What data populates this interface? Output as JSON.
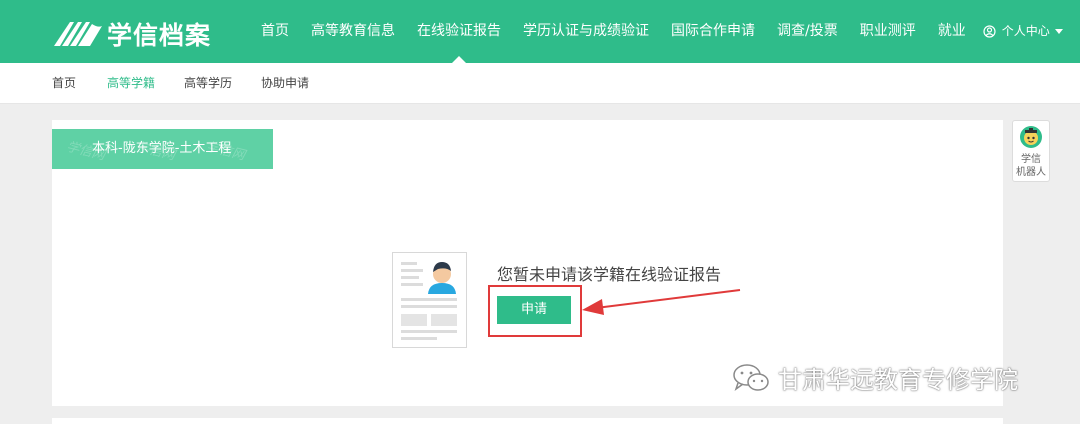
{
  "header": {
    "logo_text": "学信档案",
    "nav": [
      {
        "label": "首页"
      },
      {
        "label": "高等教育信息"
      },
      {
        "label": "在线验证报告",
        "active": true
      },
      {
        "label": "学历认证与成绩验证"
      },
      {
        "label": "国际合作申请"
      },
      {
        "label": "调查/投票"
      },
      {
        "label": "职业测评"
      },
      {
        "label": "就业"
      }
    ],
    "user_label": "个人中心",
    "bg_color": "#2fbc8a"
  },
  "subnav": {
    "items": [
      {
        "label": "首页"
      },
      {
        "label": "高等学籍",
        "active": true
      },
      {
        "label": "高等学历"
      },
      {
        "label": "协助申请"
      }
    ]
  },
  "card": {
    "tag_label": "本科-陇东学院-土木工程",
    "tag_watermark": "学信网",
    "message": "您暂未申请该学籍在线验证报告",
    "apply_label": "申请"
  },
  "robot": {
    "label_line1": "学信",
    "label_line2": "机器人"
  },
  "watermark": {
    "text": "甘肃华远教育专修学院"
  },
  "icons": {
    "logo": "book-logo-icon",
    "user": "user-circle-icon",
    "caret": "caret-down-icon",
    "illustration": "resume-person-icon",
    "arrow": "red-arrow-icon",
    "robot": "robot-avatar-icon",
    "wechat": "wechat-icon"
  },
  "colors": {
    "brand": "#2fbc8a",
    "tag": "#5fd1a5",
    "highlight": "#e03a3a"
  }
}
